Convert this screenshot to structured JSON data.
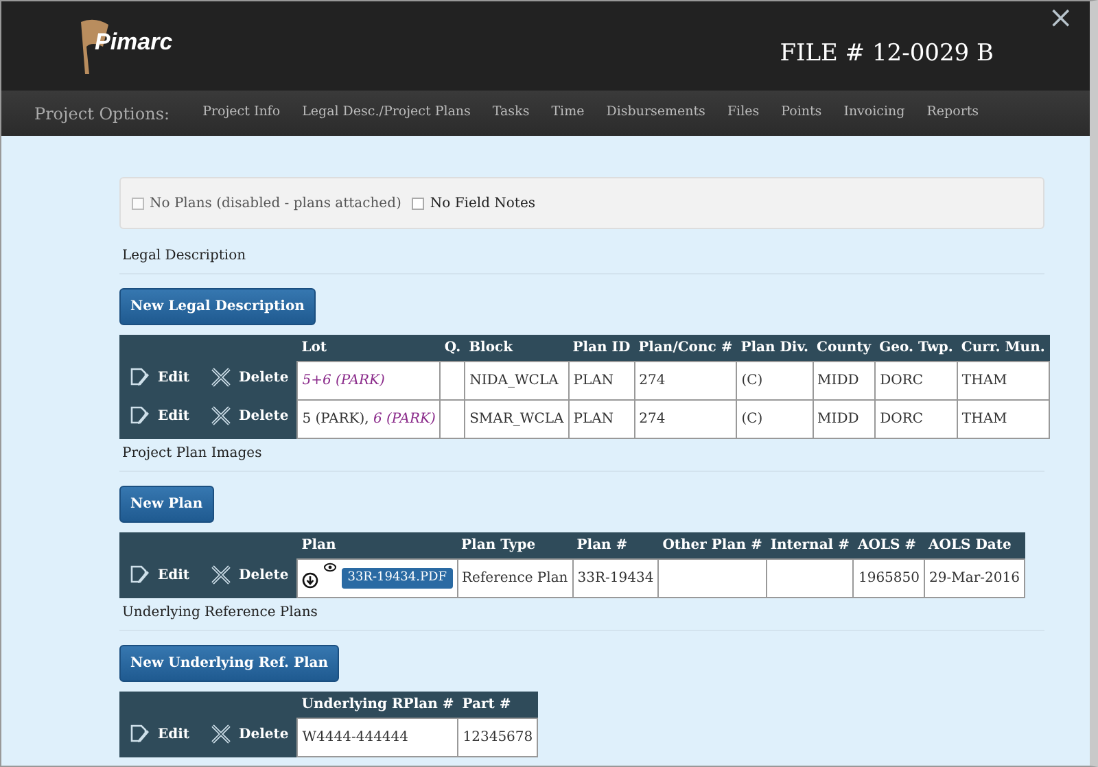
{
  "header": {
    "logo": "Pimarc",
    "file_title": "FILE # 12-0029 B",
    "close": "×"
  },
  "nav": {
    "label": "Project Options:",
    "items": [
      {
        "label": "Project Info",
        "selected": false
      },
      {
        "label": "Legal Desc./Project Plans",
        "selected": false
      },
      {
        "label": "Tasks",
        "selected": false
      },
      {
        "label": "Time",
        "selected": false
      },
      {
        "label": "Disbursements",
        "selected": false
      },
      {
        "label": "Files",
        "selected": false
      },
      {
        "label": "Points",
        "selected": false
      },
      {
        "label": "Invoicing",
        "selected": false
      },
      {
        "label": "Reports",
        "selected": false
      }
    ]
  },
  "options": [
    {
      "label": "No Plans (disabled - plans attached)",
      "checked": false,
      "disabled": true
    },
    {
      "label": "No Field Notes",
      "checked": false,
      "disabled": false
    }
  ],
  "sections": [
    {
      "title": "Legal Description",
      "button": "New Legal Description",
      "columns": [
        "Lot",
        "Q.",
        "Block",
        "Plan ID",
        "Plan/Conc #",
        "Plan Div.",
        "County",
        "Geo. Twp.",
        "Curr. Mun."
      ],
      "rows": [
        {
          "edit": "Edit",
          "delete": "Delete",
          "cells": [
            [
              {
                "text": "5+6 (PARK)",
                "linked": true
              }
            ],
            null,
            "NIDA_WCLA",
            "PLAN",
            "274",
            "(C)",
            "MIDD",
            "DORC",
            "THAM"
          ]
        },
        {
          "edit": "Edit",
          "delete": "Delete",
          "cells": [
            [
              {
                "text": "5 (PARK),",
                "linked": false
              },
              {
                "text": "6 (PARK)",
                "linked": true
              }
            ],
            null,
            "SMAR_WCLA",
            "PLAN",
            "274",
            "(C)",
            "MIDD",
            "DORC",
            "THAM"
          ]
        }
      ]
    },
    {
      "title": "Project Plan Images",
      "button": "New Plan",
      "columns": [
        "Plan",
        "Plan Type",
        "Plan #",
        "Other Plan #",
        "Internal #",
        "AOLS #",
        "AOLS Date"
      ],
      "rows": [
        {
          "edit": "Edit",
          "delete": "Delete",
          "file": "33R-19434.PDF",
          "cells": [
            null,
            "Reference Plan",
            "33R-19434",
            null,
            null,
            "1965850",
            "29-Mar-2016"
          ]
        }
      ]
    },
    {
      "title": "Underlying Reference Plans",
      "button": "New Underlying Ref. Plan",
      "columns": [
        "Underlying RPlan #",
        "Part #"
      ],
      "rows": [
        {
          "edit": "Edit",
          "delete": "Delete",
          "cells": [
            "W4444-444444",
            "12345678"
          ]
        }
      ]
    }
  ]
}
